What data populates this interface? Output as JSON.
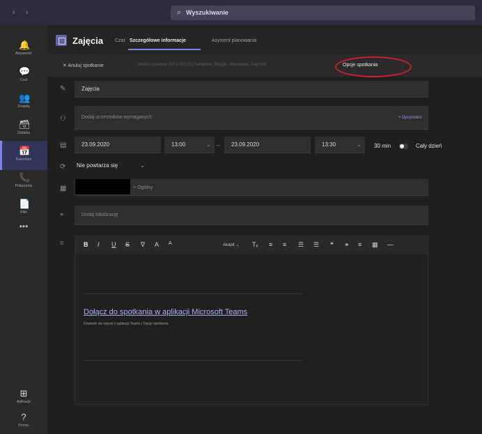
{
  "topbar": {
    "nav_arrows": "‹ ›",
    "search_icon": "search-icon",
    "search_text": "Wyszukiwanie"
  },
  "rail": {
    "items": [
      {
        "label": "Aktywność",
        "icon": "bell-icon",
        "glyph": "🔔"
      },
      {
        "label": "Czat",
        "icon": "chat-icon",
        "glyph": "💬"
      },
      {
        "label": "Zespoły",
        "icon": "teams-icon",
        "glyph": "👥"
      },
      {
        "label": "Zadania",
        "icon": "bag-icon",
        "glyph": "🗃"
      },
      {
        "label": "Kalendarz",
        "icon": "calendar-icon",
        "glyph": "📅"
      },
      {
        "label": "Połączenia",
        "icon": "phone-icon",
        "glyph": "📞"
      },
      {
        "label": "Pliki",
        "icon": "file-icon",
        "glyph": "📄"
      }
    ],
    "more": "•••",
    "apps_label": "Aplikacje",
    "help_label": "Pomoc"
  },
  "header": {
    "title": "Zajęcia",
    "tabs": [
      {
        "label": "Czat"
      },
      {
        "label": "Szczegółowe informacje"
      },
      {
        "label": "Asystent planowania"
      }
    ]
  },
  "toolbar": {
    "close_label": "✕ Anuluj spotkanie",
    "faded_text": "Strefa czasowa: (UTC+01:00) Sarajewo, Skopje, Warszawa, Zagrzeb",
    "options_label": "Opcje spotkania"
  },
  "form": {
    "title_value": "Zajęcia",
    "attendees_placeholder": "Dodaj uczestników wymaganych",
    "attendees_link": "+ Opcjonalni",
    "start_date": "23.09.2020",
    "start_time": "13:00",
    "end_date": "23.09.2020",
    "end_time": "13:30",
    "duration": "30 min",
    "all_day": "Cały dzień",
    "recurrence": "Nie powtarza się",
    "channel_placeholder": "> Ogólny",
    "location_placeholder": "Dodaj lokalizację"
  },
  "editor": {
    "toolbar": [
      "B",
      "I",
      "U",
      "S",
      "∇",
      "A",
      "A",
      "Tₓ",
      "≡",
      "≡",
      "☰",
      "☰",
      "❝",
      "⚭",
      "≡",
      "▦",
      "—"
    ],
    "font_size_label": "Akapit ⌄",
    "join_link": "Dołącz do spotkania w aplikacji Microsoft Teams",
    "join_sub": "Dowiedz się więcej o aplikacji Teams | Opcje spotkania"
  },
  "colors": {
    "accent": "#7b83eb",
    "highlight_ring": "#d01f2e"
  }
}
